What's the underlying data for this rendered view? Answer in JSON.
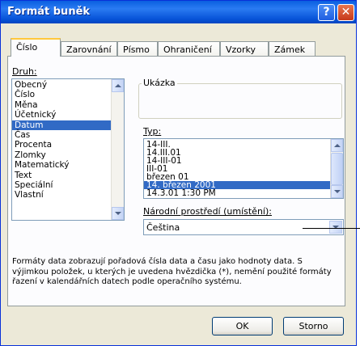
{
  "window": {
    "title": "Formát buněk",
    "help_label": "?",
    "close_label": "✕"
  },
  "tabs": [
    "Číslo",
    "Zarovnání",
    "Písmo",
    "Ohraničení",
    "Vzorky",
    "Zámek"
  ],
  "category": {
    "label": "Druh:",
    "items": [
      "Obecný",
      "Číslo",
      "Měna",
      "Účetnický",
      "Datum",
      "Čas",
      "Procenta",
      "Zlomky",
      "Matematický",
      "Text",
      "Speciální",
      "Vlastní"
    ],
    "selected": "Datum"
  },
  "sample": {
    "label": "Ukázka",
    "value": ""
  },
  "type": {
    "label": "Typ:",
    "items": [
      "14-III.",
      "14.III.01",
      "14-III-01",
      "III-01",
      "březen 01",
      "14. březen 2001",
      "14.3.01 1:30 PM"
    ],
    "selected": "14. březen 2001"
  },
  "locale": {
    "label": "Národní prostředí (umístění):",
    "value": "Čeština"
  },
  "description": "Formáty data zobrazují pořadová čísla data a času jako hodnoty data. S výjimkou položek, u kterých je uvedena hvězdička (*), nemění použité formáty řazení v kalendářních datech podle operačního systému.",
  "buttons": {
    "ok": "OK",
    "cancel": "Storno"
  }
}
